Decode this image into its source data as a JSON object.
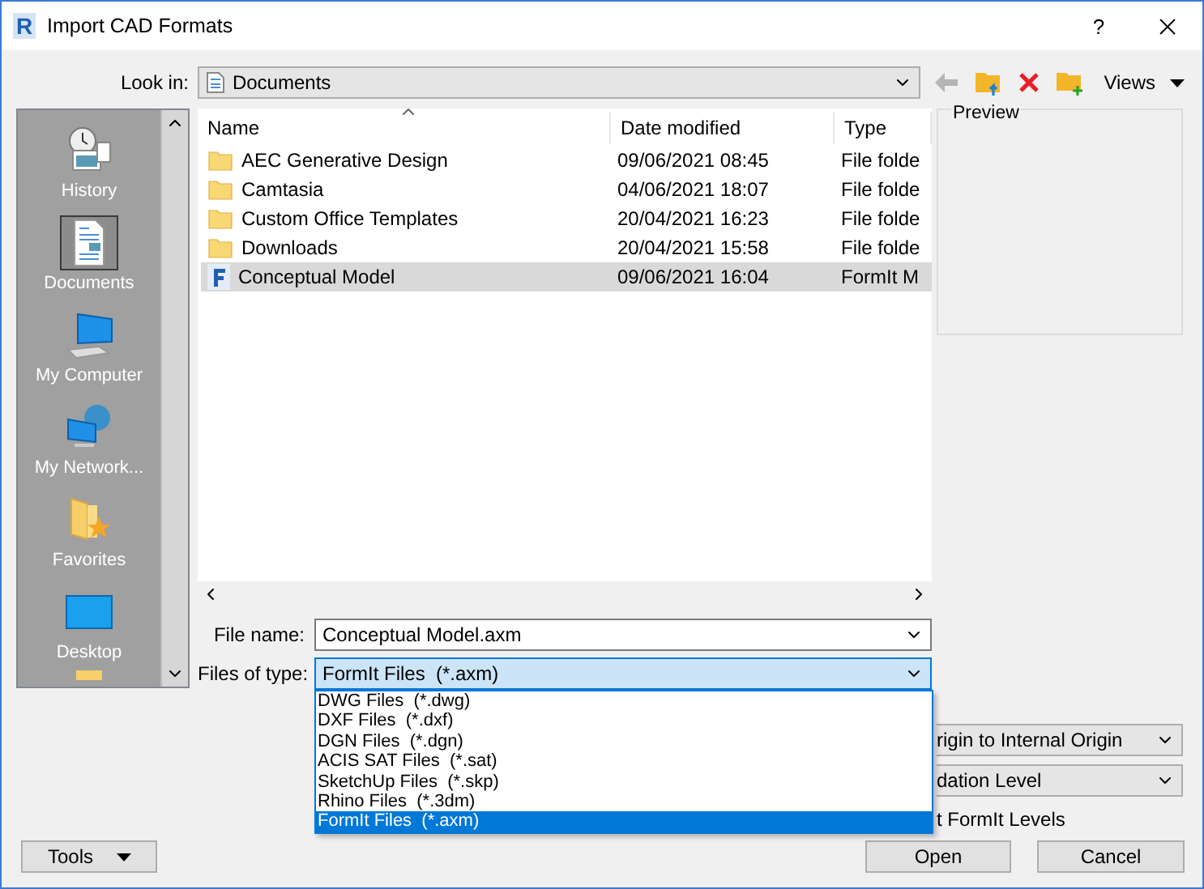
{
  "window": {
    "logo": "R",
    "title": "Import CAD Formats",
    "help": "?"
  },
  "look_in": {
    "label": "Look in:",
    "value": "Documents"
  },
  "toolbar": {
    "back_disabled": true,
    "views": "Views"
  },
  "places": [
    {
      "kind": "history",
      "label": "History",
      "selected": false
    },
    {
      "kind": "documents",
      "label": "Documents",
      "selected": true
    },
    {
      "kind": "computer",
      "label": "My Computer",
      "selected": false
    },
    {
      "kind": "network",
      "label": "My Network...",
      "selected": false
    },
    {
      "kind": "favorites",
      "label": "Favorites",
      "selected": false
    },
    {
      "kind": "desktop",
      "label": "Desktop",
      "selected": false
    },
    {
      "kind": "folder",
      "selected": false
    }
  ],
  "file_list": {
    "columns": [
      "Name",
      "Date modified",
      "Type"
    ],
    "rows": [
      {
        "kind": "folder",
        "name": "AEC Generative Design",
        "date": "09/06/2021 08:45",
        "type": "File folde",
        "selected": false
      },
      {
        "kind": "folder",
        "name": "Camtasia",
        "date": "04/06/2021 18:07",
        "type": "File folde",
        "selected": false
      },
      {
        "kind": "folder",
        "name": "Custom Office Templates",
        "date": "20/04/2021 16:23",
        "type": "File folde",
        "selected": false
      },
      {
        "kind": "folder",
        "name": "Downloads",
        "date": "20/04/2021 15:58",
        "type": "File folde",
        "selected": false
      },
      {
        "kind": "formit",
        "name": "Conceptual Model",
        "date": "09/06/2021 16:04",
        "type": "FormIt M",
        "selected": true
      }
    ]
  },
  "preview": {
    "label": "Preview"
  },
  "file_name": {
    "label": "File name:",
    "value": "Conceptual Model.axm"
  },
  "files_of_type": {
    "label": "Files of type:",
    "value": "FormIt Files  (*.axm)",
    "expanded": true,
    "options": [
      {
        "label": "DWG Files  (*.dwg)",
        "selected": false
      },
      {
        "label": "DXF Files  (*.dxf)",
        "selected": false
      },
      {
        "label": "DGN Files  (*.dgn)",
        "selected": false
      },
      {
        "label": "ACIS SAT Files  (*.sat)",
        "selected": false
      },
      {
        "label": "SketchUp Files  (*.skp)",
        "selected": false
      },
      {
        "label": "Rhino Files  (*.3dm)",
        "selected": false
      },
      {
        "label": "FormIt Files  (*.axm)",
        "selected": true
      }
    ]
  },
  "import_options": {
    "combos": [
      "rigin to Internal Origin",
      "dation Level"
    ],
    "checkbox_label": "t FormIt Levels"
  },
  "buttons": {
    "tools": "Tools",
    "open": "Open",
    "cancel": "Cancel"
  }
}
